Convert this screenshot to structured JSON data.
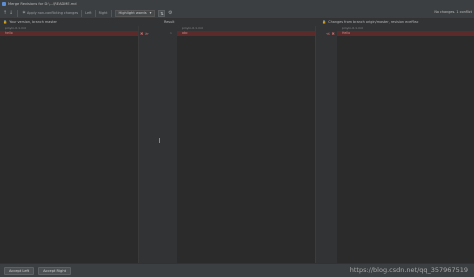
{
  "window": {
    "title": "Merge Revisions for D:\\...\\README.md"
  },
  "toolbar": {
    "apply_changes_label": "Apply non-conflicting changes",
    "left_label": "Left",
    "right_label": "Right",
    "highlight_select": "Highlight words",
    "status": "No changes. 1 conflict"
  },
  "headers": {
    "left": "Your version, branch master",
    "center": "Result",
    "right": "Changes from branch origin/master, revision ecef9ac"
  },
  "panels": {
    "left": {
      "path": "pinyin-0.1.md",
      "line": "hello"
    },
    "center": {
      "path": "pinyin-0.1.md",
      "line": "abc"
    },
    "right": {
      "path": "pinyin-0.1.md",
      "line": "Hello"
    }
  },
  "gutter": {
    "left_marks": "✖ ≫",
    "right_marks": "≪ ✖",
    "line_no": "1"
  },
  "footer": {
    "accept_left": "Accept Left",
    "accept_right": "Accept Right"
  },
  "watermark": "https://blog.csdn.net/qq_357967519",
  "colors": {
    "background": "#2b2b2b",
    "conflict": "#5b2a2a",
    "toolbar": "#3c3f41"
  }
}
